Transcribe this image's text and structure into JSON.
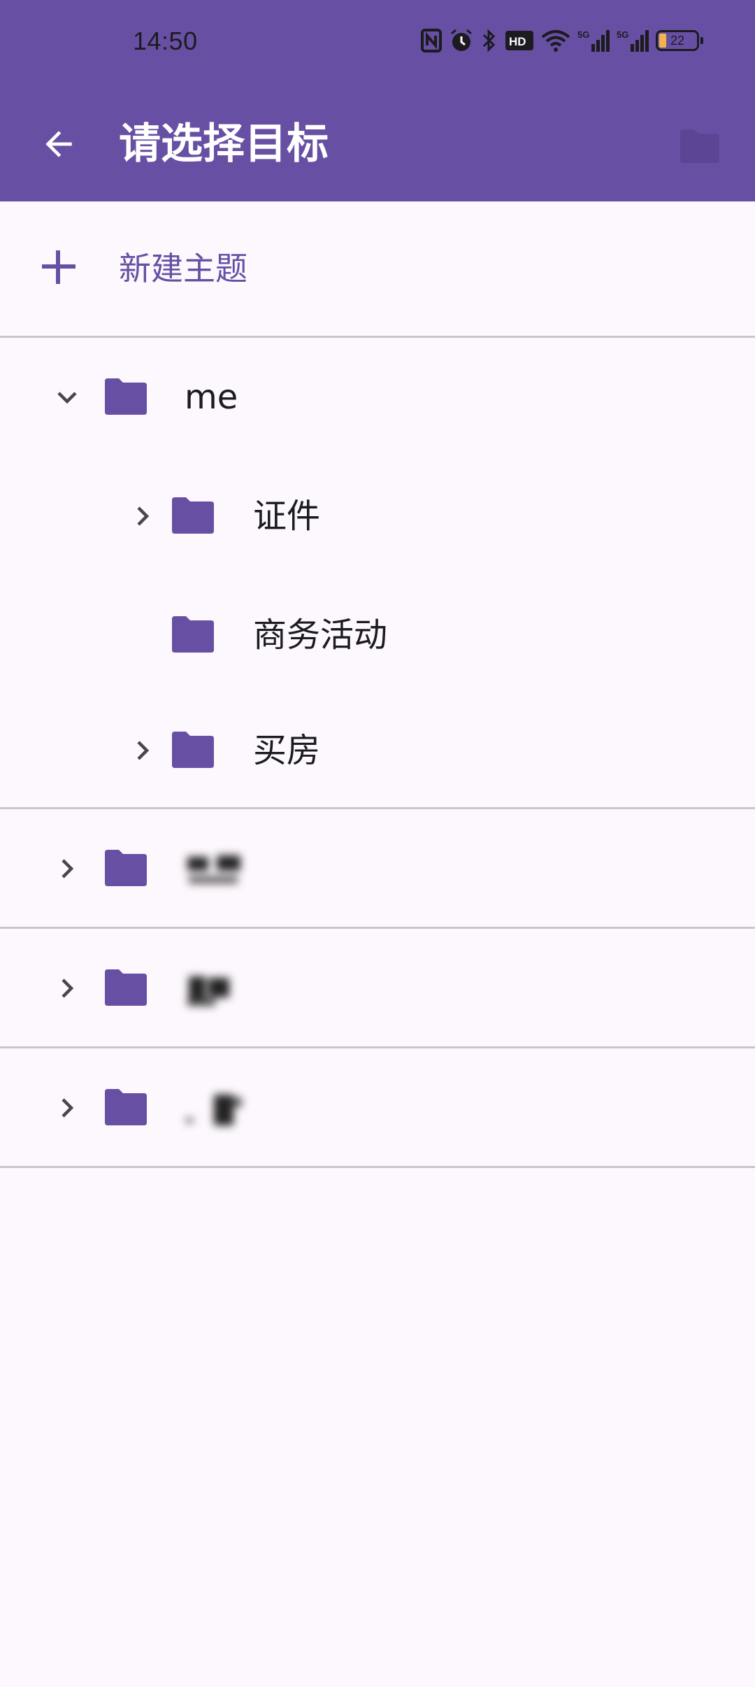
{
  "status_bar": {
    "time": "14:50",
    "battery_level": "22",
    "icons": [
      "nfc-icon",
      "alarm-icon",
      "bluetooth-icon",
      "hd-icon",
      "wifi-icon",
      "signal-5g-icon",
      "signal-5g-icon",
      "battery-icon"
    ]
  },
  "toolbar": {
    "title": "请选择目标",
    "back_icon": "arrow-back-icon",
    "action_icon": "folder-icon"
  },
  "new_topic": {
    "label": "新建主题",
    "icon": "plus-icon"
  },
  "tree": {
    "root": {
      "name": "me",
      "expanded": true,
      "children": [
        {
          "name": "证件",
          "has_children": true
        },
        {
          "name": "商务活动",
          "has_children": false
        },
        {
          "name": "买房",
          "has_children": true
        }
      ]
    },
    "others": [
      {
        "name": "",
        "has_children": true,
        "blurred": true
      },
      {
        "name": "",
        "has_children": true,
        "blurred": true
      },
      {
        "name": "",
        "has_children": true,
        "blurred": true
      }
    ]
  },
  "colors": {
    "primary": "#6750a4",
    "background": "#fdf8fd",
    "divider": "#cac4d0",
    "text": "#1c1b1f"
  }
}
